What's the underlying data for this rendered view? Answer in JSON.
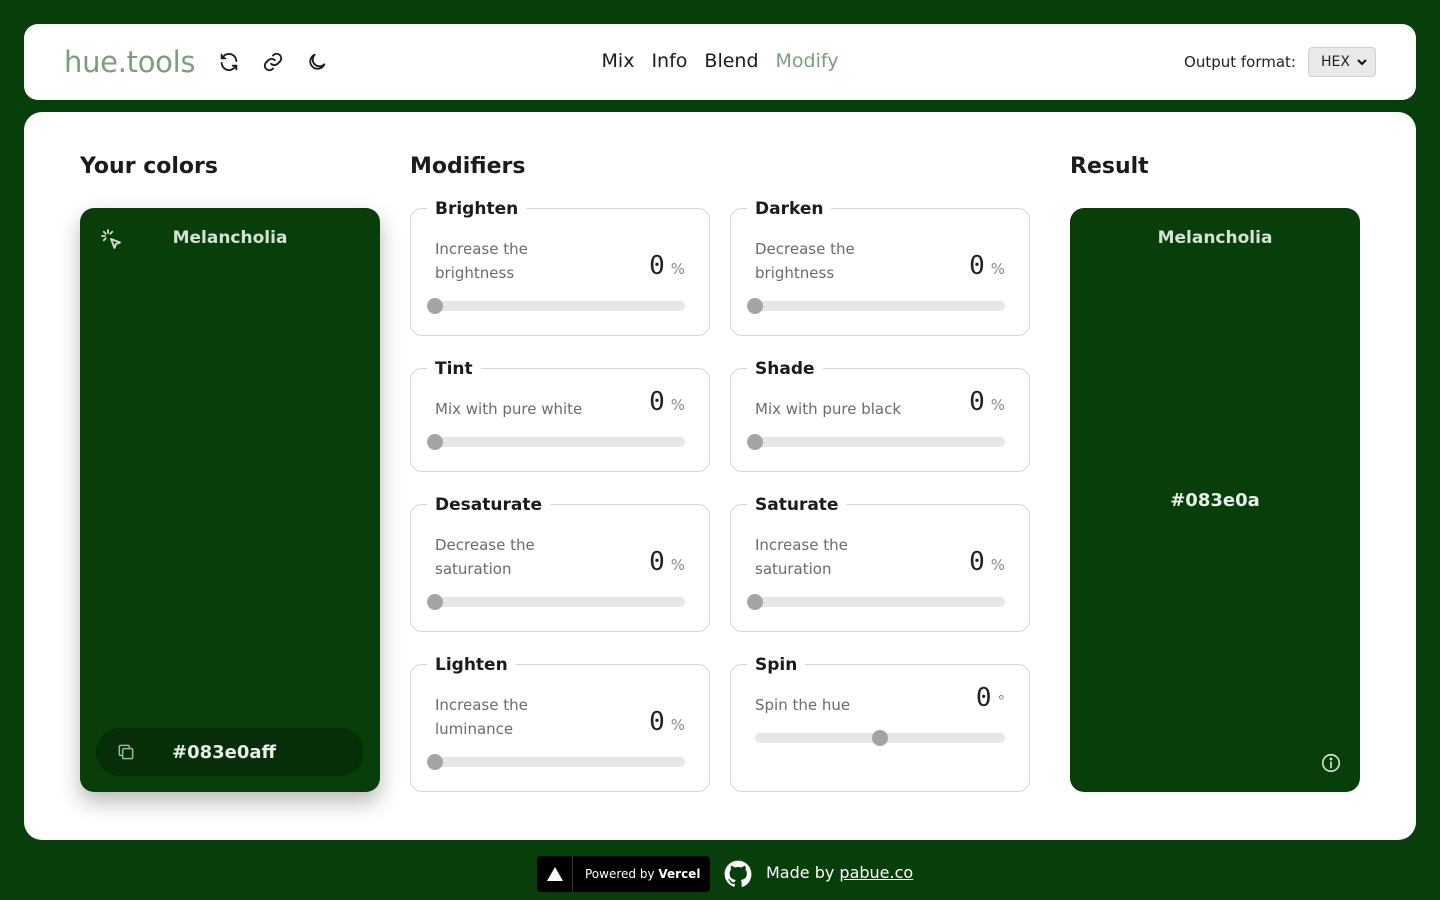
{
  "header": {
    "logo": "hue.tools",
    "icons": [
      "refresh-icon",
      "link-icon",
      "moon-icon"
    ],
    "nav": [
      {
        "label": "Mix",
        "active": false
      },
      {
        "label": "Info",
        "active": false
      },
      {
        "label": "Blend",
        "active": false
      },
      {
        "label": "Modify",
        "active": true
      }
    ],
    "output_label": "Output format:",
    "output_value": "HEX"
  },
  "your_colors": {
    "title": "Your colors",
    "color": {
      "name": "Melancholia",
      "hex": "#083e0aff",
      "swatch": "#083e0a"
    }
  },
  "modifiers": {
    "title": "Modifiers",
    "items": [
      {
        "title": "Brighten",
        "desc": "Increase the brightness",
        "value": "0",
        "unit": "%",
        "slider": 0
      },
      {
        "title": "Darken",
        "desc": "Decrease the brightness",
        "value": "0",
        "unit": "%",
        "slider": 0
      },
      {
        "title": "Tint",
        "desc": "Mix with pure white",
        "value": "0",
        "unit": "%",
        "slider": 0
      },
      {
        "title": "Shade",
        "desc": "Mix with pure black",
        "value": "0",
        "unit": "%",
        "slider": 0
      },
      {
        "title": "Desaturate",
        "desc": "Decrease the saturation",
        "value": "0",
        "unit": "%",
        "slider": 0
      },
      {
        "title": "Saturate",
        "desc": "Increase the saturation",
        "value": "0",
        "unit": "%",
        "slider": 0
      },
      {
        "title": "Lighten",
        "desc": "Increase the luminance",
        "value": "0",
        "unit": "%",
        "slider": 0
      },
      {
        "title": "Spin",
        "desc": "Spin the hue",
        "value": "0",
        "unit": "°",
        "slider": 0.5
      }
    ]
  },
  "result": {
    "title": "Result",
    "name": "Melancholia",
    "hex": "#083e0a"
  },
  "footer": {
    "powered_prefix": "Powered by ",
    "powered_brand": "Vercel",
    "made_by": "Made by ",
    "made_by_link": "pabue.co"
  },
  "colors": {
    "background": "#083e0a",
    "accent": "#7d9e7e",
    "swatch": "#083e0a"
  }
}
